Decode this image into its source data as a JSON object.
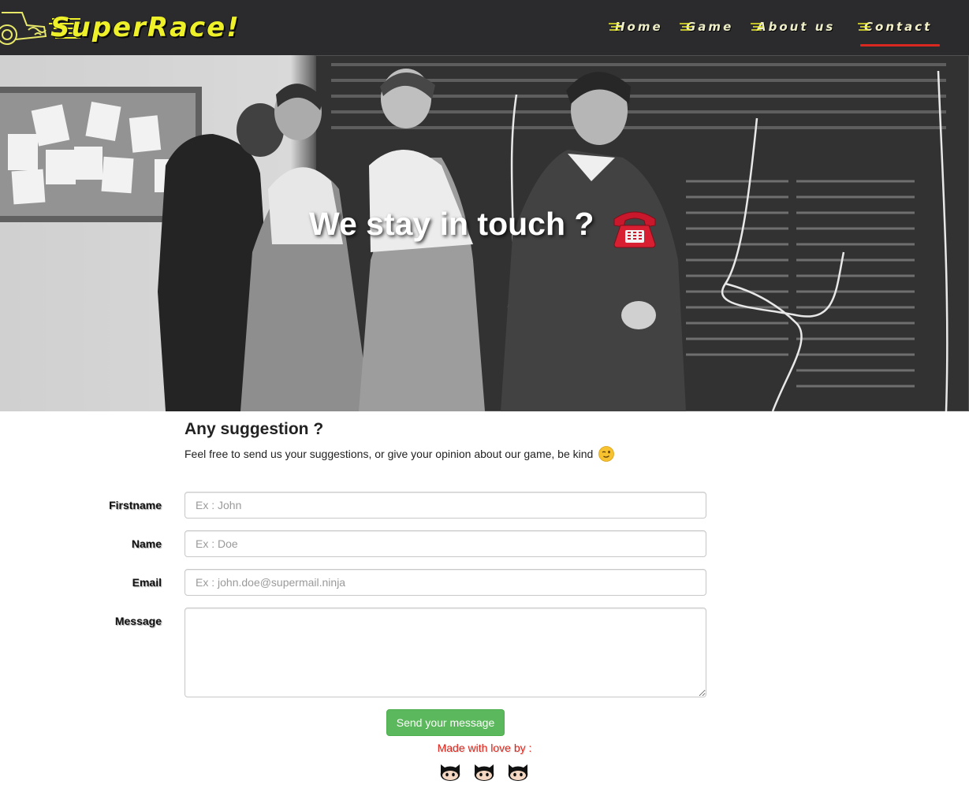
{
  "header": {
    "logo_text": "SuperRace!",
    "nav": [
      {
        "label": "Home",
        "active": false
      },
      {
        "label": "Game",
        "active": false
      },
      {
        "label": "About us",
        "active": false
      },
      {
        "label": "Contact",
        "active": true
      }
    ],
    "accent_color": "#eef02a",
    "active_underline_color": "#d9281f",
    "background": "#2b2b2d"
  },
  "hero": {
    "title": "We stay in touch ?",
    "icon": "telephone-icon"
  },
  "suggestion": {
    "title": "Any suggestion ?",
    "text": "Feel free to send us your suggestions, or give your opinion about our game, be kind",
    "icon": "wink-emoji-icon"
  },
  "form": {
    "firstname": {
      "label": "Firstname",
      "placeholder": "Ex : John",
      "value": ""
    },
    "name": {
      "label": "Name",
      "placeholder": "Ex : Doe",
      "value": ""
    },
    "email": {
      "label": "Email",
      "placeholder": "Ex : john.doe@supermail.ninja",
      "value": ""
    },
    "message": {
      "label": "Message",
      "placeholder": "",
      "value": ""
    },
    "submit_label": "Send your message",
    "submit_color": "#5cb85c"
  },
  "footer": {
    "made_with": "Made with love by :",
    "authors_icons": [
      "github-icon",
      "github-icon",
      "github-icon"
    ],
    "made_with_color": "#e0261c"
  }
}
